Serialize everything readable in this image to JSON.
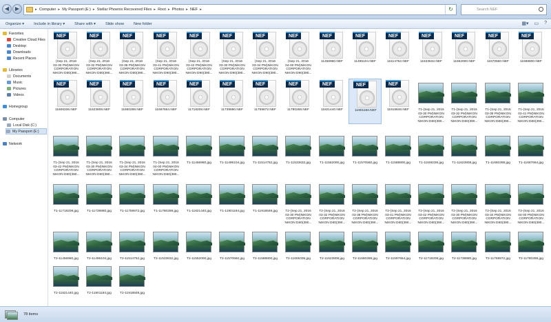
{
  "address": {
    "breadcrumbs": [
      "Computer",
      "My Passport (E:)",
      "Stellar Phoenix Recovered Files",
      "Root",
      "Photos",
      "NEF"
    ],
    "search_placeholder": "Search NEF"
  },
  "toolbar": {
    "items": [
      "Organize ▾",
      "Include in library ▾",
      "Share with ▾",
      "Slide show",
      "New folder"
    ]
  },
  "nav": {
    "items": [
      {
        "label": "Favorites",
        "color": "#e2b93b"
      },
      {
        "label": "Creative Cloud Files",
        "color": "#d64b3b"
      },
      {
        "label": "Desktop",
        "color": "#4a86c8"
      },
      {
        "label": "Downloads",
        "color": "#4a86c8"
      },
      {
        "label": "Recent Places",
        "color": "#4a86c8"
      },
      {
        "label": "Libraries",
        "color": "#e2b93b"
      },
      {
        "label": "Documents",
        "color": "#cfcfcf"
      },
      {
        "label": "Music",
        "color": "#6a9ad0"
      },
      {
        "label": "Pictures",
        "color": "#7fb07a"
      },
      {
        "label": "Videos",
        "color": "#5c7ea8"
      },
      {
        "label": "Homegroup",
        "color": "#3f8dd6"
      },
      {
        "label": "Computer",
        "color": "#7a8ea8"
      },
      {
        "label": "Local Disk (C:)",
        "color": "#9aa9bb"
      },
      {
        "label": "My Passport (E:)",
        "color": "#9aa9bb"
      },
      {
        "label": "Network",
        "color": "#4a7fc0"
      }
    ]
  },
  "files": [
    {
      "label": "(Sep 21, 2016\n03-30 PM)NIKON\nCORPORATION\nNIKON D80(390...",
      "kind": "nef"
    },
    {
      "label": "(Sep 21, 2016\n03-32 PM)NIKON\nCORPORATION\nNIKON D80(390...",
      "kind": "nef"
    },
    {
      "label": "(Sep 21, 2016\n03-38 PM)NIKON\nCORPORATION\nNIKON D80(390...",
      "kind": "nef"
    },
    {
      "label": "(Sep 21, 2016\n03-41 PM)NIKON\nCORPORATION\nNIKON D80(390...",
      "kind": "nef"
    },
    {
      "label": "(Sep 21, 2016\n03-42 PM)NIKON\nCORPORATION\nNIKON D80(390...",
      "kind": "nef"
    },
    {
      "label": "(Sep 21, 2016\n03-30 PM)NIKON\nCORPORATION\nNIKON D80(390...",
      "kind": "nef"
    },
    {
      "label": "(Sep 21, 2016\n03-34 PM)NIKON\nCORPORATION\nNIKON D80(390...",
      "kind": "nef"
    },
    {
      "label": "(Sep 21, 2016\n04-00 PM)NIKON\nCORPORATION\nNIKON D80(390...",
      "kind": "nef"
    },
    {
      "label": "11456960.NEF",
      "kind": "nef"
    },
    {
      "label": "11495104.NEF",
      "kind": "nef"
    },
    {
      "label": "11514752.NEF",
      "kind": "nef"
    },
    {
      "label": "11533632.NEF",
      "kind": "nef"
    },
    {
      "label": "11552000.NEF",
      "kind": "nef"
    },
    {
      "label": "11570560.NEF",
      "kind": "nef"
    },
    {
      "label": "11588800.NEF",
      "kind": "nef"
    },
    {
      "label": "11606336.NEF",
      "kind": "nef"
    },
    {
      "label": "11623808.NEF",
      "kind": "nef"
    },
    {
      "label": "11660288.NEF",
      "kind": "nef"
    },
    {
      "label": "11697664.NEF",
      "kind": "nef"
    },
    {
      "label": "11718208.NEF",
      "kind": "nef"
    },
    {
      "label": "11738880.NEF",
      "kind": "nef"
    },
    {
      "label": "11759872.NEF",
      "kind": "nef"
    },
    {
      "label": "11780288.NEF",
      "kind": "nef"
    },
    {
      "label": "11821440.NEF",
      "kind": "nef"
    },
    {
      "label": "11901184.NEF",
      "kind": "nef",
      "selected": true
    },
    {
      "label": "11918848.NEF",
      "kind": "nef"
    },
    {
      "label": "T1-(Sep 21, 2016\n03-30 PM)NIKON\nCORPORATION\nNIKON D80(390...",
      "kind": "jpg"
    },
    {
      "label": "T1-(Sep 21, 2016\n03-32 PM)NIKON\nCORPORATION\nNIKON D80(390...",
      "kind": "jpg"
    },
    {
      "label": "T1-(Sep 21, 2016\n03-38 PM)NIKON\nCORPORATION\nNIKON D80(390...",
      "kind": "jpg"
    },
    {
      "label": "T1-(Sep 21, 2016\n03-41 PM)NIKON\nCORPORATION\nNIKON D80(390...",
      "kind": "jpg"
    },
    {
      "label": "T1-(Sep 21, 2016\n03-42 PM)NIKON\nCORPORATION\nNIKON D80(390...",
      "kind": "jpg"
    },
    {
      "label": "T1-(Sep 21, 2016\n03-30 PM)NIKON\nCORPORATION\nNIKON D80(390...",
      "kind": "jpg"
    },
    {
      "label": "T1-(Sep 21, 2016\n03-34 PM)NIKON\nCORPORATION\nNIKON D80(390...",
      "kind": "jpg"
    },
    {
      "label": "T1-(Sep 21, 2016\n04-00 PM)NIKON\nCORPORATION\nNIKON D80(390...",
      "kind": "jpg"
    },
    {
      "label": "T1-11456960.jpg",
      "kind": "jpg"
    },
    {
      "label": "T1-11495104.jpg",
      "kind": "jpg"
    },
    {
      "label": "T1-11514752.jpg",
      "kind": "jpg"
    },
    {
      "label": "T1-11533632.jpg",
      "kind": "jpg"
    },
    {
      "label": "T1-11552000.jpg",
      "kind": "jpg"
    },
    {
      "label": "T1-11570560.jpg",
      "kind": "jpg"
    },
    {
      "label": "T1-11588800.jpg",
      "kind": "jpg"
    },
    {
      "label": "T1-11606336.jpg",
      "kind": "jpg"
    },
    {
      "label": "T1-11623808.jpg",
      "kind": "jpg"
    },
    {
      "label": "T1-11660288.jpg",
      "kind": "jpg"
    },
    {
      "label": "T1-11697664.jpg",
      "kind": "jpg"
    },
    {
      "label": "T1-11718208.jpg",
      "kind": "jpg"
    },
    {
      "label": "T1-11738880.jpg",
      "kind": "jpg"
    },
    {
      "label": "T1-11759872.jpg",
      "kind": "jpg"
    },
    {
      "label": "T1-11780288.jpg",
      "kind": "jpg"
    },
    {
      "label": "T1-11821440.jpg",
      "kind": "jpg"
    },
    {
      "label": "T1-11901184.jpg",
      "kind": "jpg"
    },
    {
      "label": "T1-11918848.jpg",
      "kind": "jpg"
    },
    {
      "label": "T2-(Sep 21, 2016\n03-30 PM)NIKON\nCORPORATION\nNIKON D80(390...",
      "kind": "jpg"
    },
    {
      "label": "T2-(Sep 21, 2016\n03-32 PM)NIKON\nCORPORATION\nNIKON D80(390...",
      "kind": "jpg"
    },
    {
      "label": "T2-(Sep 21, 2016\n03-38 PM)NIKON\nCORPORATION\nNIKON D80(390...",
      "kind": "jpg"
    },
    {
      "label": "T2-(Sep 21, 2016\n03-41 PM)NIKON\nCORPORATION\nNIKON D80(390...",
      "kind": "jpg"
    },
    {
      "label": "T2-(Sep 21, 2016\n03-42 PM)NIKON\nCORPORATION\nNIKON D80(390...",
      "kind": "jpg"
    },
    {
      "label": "T2-(Sep 21, 2016\n03-30 PM)NIKON\nCORPORATION\nNIKON D80(390...",
      "kind": "jpg"
    },
    {
      "label": "T2-(Sep 21, 2016\n03-34 PM)NIKON\nCORPORATION\nNIKON D80(390...",
      "kind": "jpg"
    },
    {
      "label": "T2-(Sep 21, 2016\n04-00 PM)NIKON\nCORPORATION\nNIKON D80(390...",
      "kind": "jpg"
    },
    {
      "label": "T2-11456960.jpg",
      "kind": "jpg"
    },
    {
      "label": "T2-11495104.jpg",
      "kind": "jpg"
    },
    {
      "label": "T2-11514752.jpg",
      "kind": "jpg"
    },
    {
      "label": "T2-11533632.jpg",
      "kind": "jpg"
    },
    {
      "label": "T2-11552000.jpg",
      "kind": "jpg"
    },
    {
      "label": "T2-11570560.jpg",
      "kind": "jpg"
    },
    {
      "label": "T2-11588800.jpg",
      "kind": "jpg"
    },
    {
      "label": "T2-11606336.jpg",
      "kind": "jpg"
    },
    {
      "label": "T2-11623808.jpg",
      "kind": "jpg"
    },
    {
      "label": "T2-11660288.jpg",
      "kind": "jpg"
    },
    {
      "label": "T2-11697664.jpg",
      "kind": "jpg"
    },
    {
      "label": "T2-11718208.jpg",
      "kind": "jpg"
    },
    {
      "label": "T2-11738880.jpg",
      "kind": "jpg"
    },
    {
      "label": "T2-11759872.jpg",
      "kind": "jpg"
    },
    {
      "label": "T2-11780288.jpg",
      "kind": "jpg"
    },
    {
      "label": "T2-11821440.jpg",
      "kind": "jpg"
    },
    {
      "label": "T2-11901184.jpg",
      "kind": "jpg"
    },
    {
      "label": "T2-11918848.jpg",
      "kind": "jpg"
    }
  ],
  "status": {
    "text": "78 items"
  },
  "nef_badge": "NEF"
}
